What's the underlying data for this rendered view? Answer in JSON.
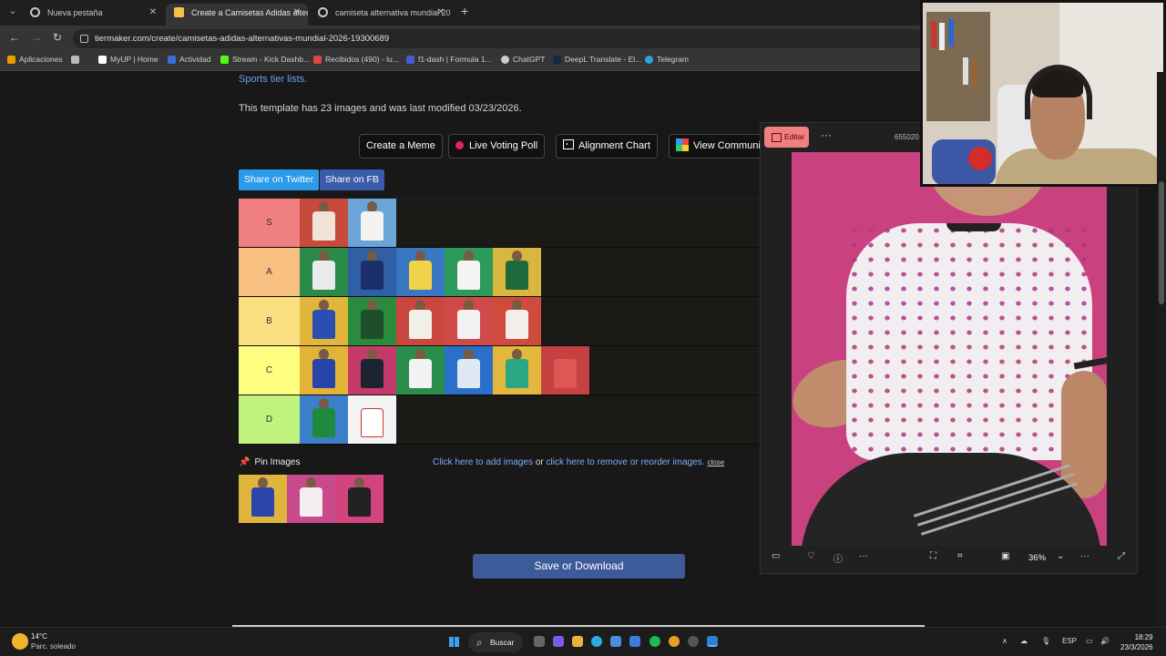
{
  "browser": {
    "tabs": [
      {
        "label": "Nueva pestaña",
        "active": false
      },
      {
        "label": "Create a Camisetas Adidas alter",
        "active": true
      },
      {
        "label": "camiseta alternativa mundial 20",
        "active": false
      }
    ],
    "url": "tiermaker.com/create/camisetas-adidas-alternativas-mundial-2026-19300689",
    "bookmarks": [
      "Aplicaciones",
      "MyUP | Home",
      "Actividad",
      "Stream - Kick Dashb...",
      "Recibidos (490) - lu...",
      "f1-dash | Formula 1...",
      "ChatGPT",
      "DeepL Translate - El...",
      "Telegram"
    ]
  },
  "page": {
    "sports_link": "Sports tier lists.",
    "template_info": "This template has 23 images and was last modified 03/23/2026.",
    "buttons": {
      "create_meme": "Create a Meme",
      "live_voting": "Live Voting Poll",
      "alignment": "Alignment Chart",
      "community": "View Communi"
    },
    "share_twitter": "Share on Twitter",
    "share_fb": "Share on FB",
    "tiers": [
      {
        "label": "S",
        "color": "#f07f7f",
        "images": 2
      },
      {
        "label": "A",
        "color": "#f7bf80",
        "images": 5
      },
      {
        "label": "B",
        "color": "#f9df80",
        "images": 5
      },
      {
        "label": "C",
        "color": "#fdfd7f",
        "images": 6
      },
      {
        "label": "D",
        "color": "#bff27f",
        "images": 2
      }
    ],
    "pin_label": "Pin Images",
    "add_text": {
      "add_link": "Click here to add images",
      "or": " or ",
      "remove_link": "click here to remove or reorder images.",
      "close": "close"
    },
    "save_button": "Save or Download"
  },
  "viewer": {
    "edit_label": "Editar",
    "file_number": "655020",
    "zoom": "36%"
  },
  "taskbar": {
    "temperature": "14°C",
    "weather": "Parc. soleado",
    "search": "Buscar",
    "language": "ESP",
    "time": "18:29",
    "date": "23/3/2026"
  }
}
